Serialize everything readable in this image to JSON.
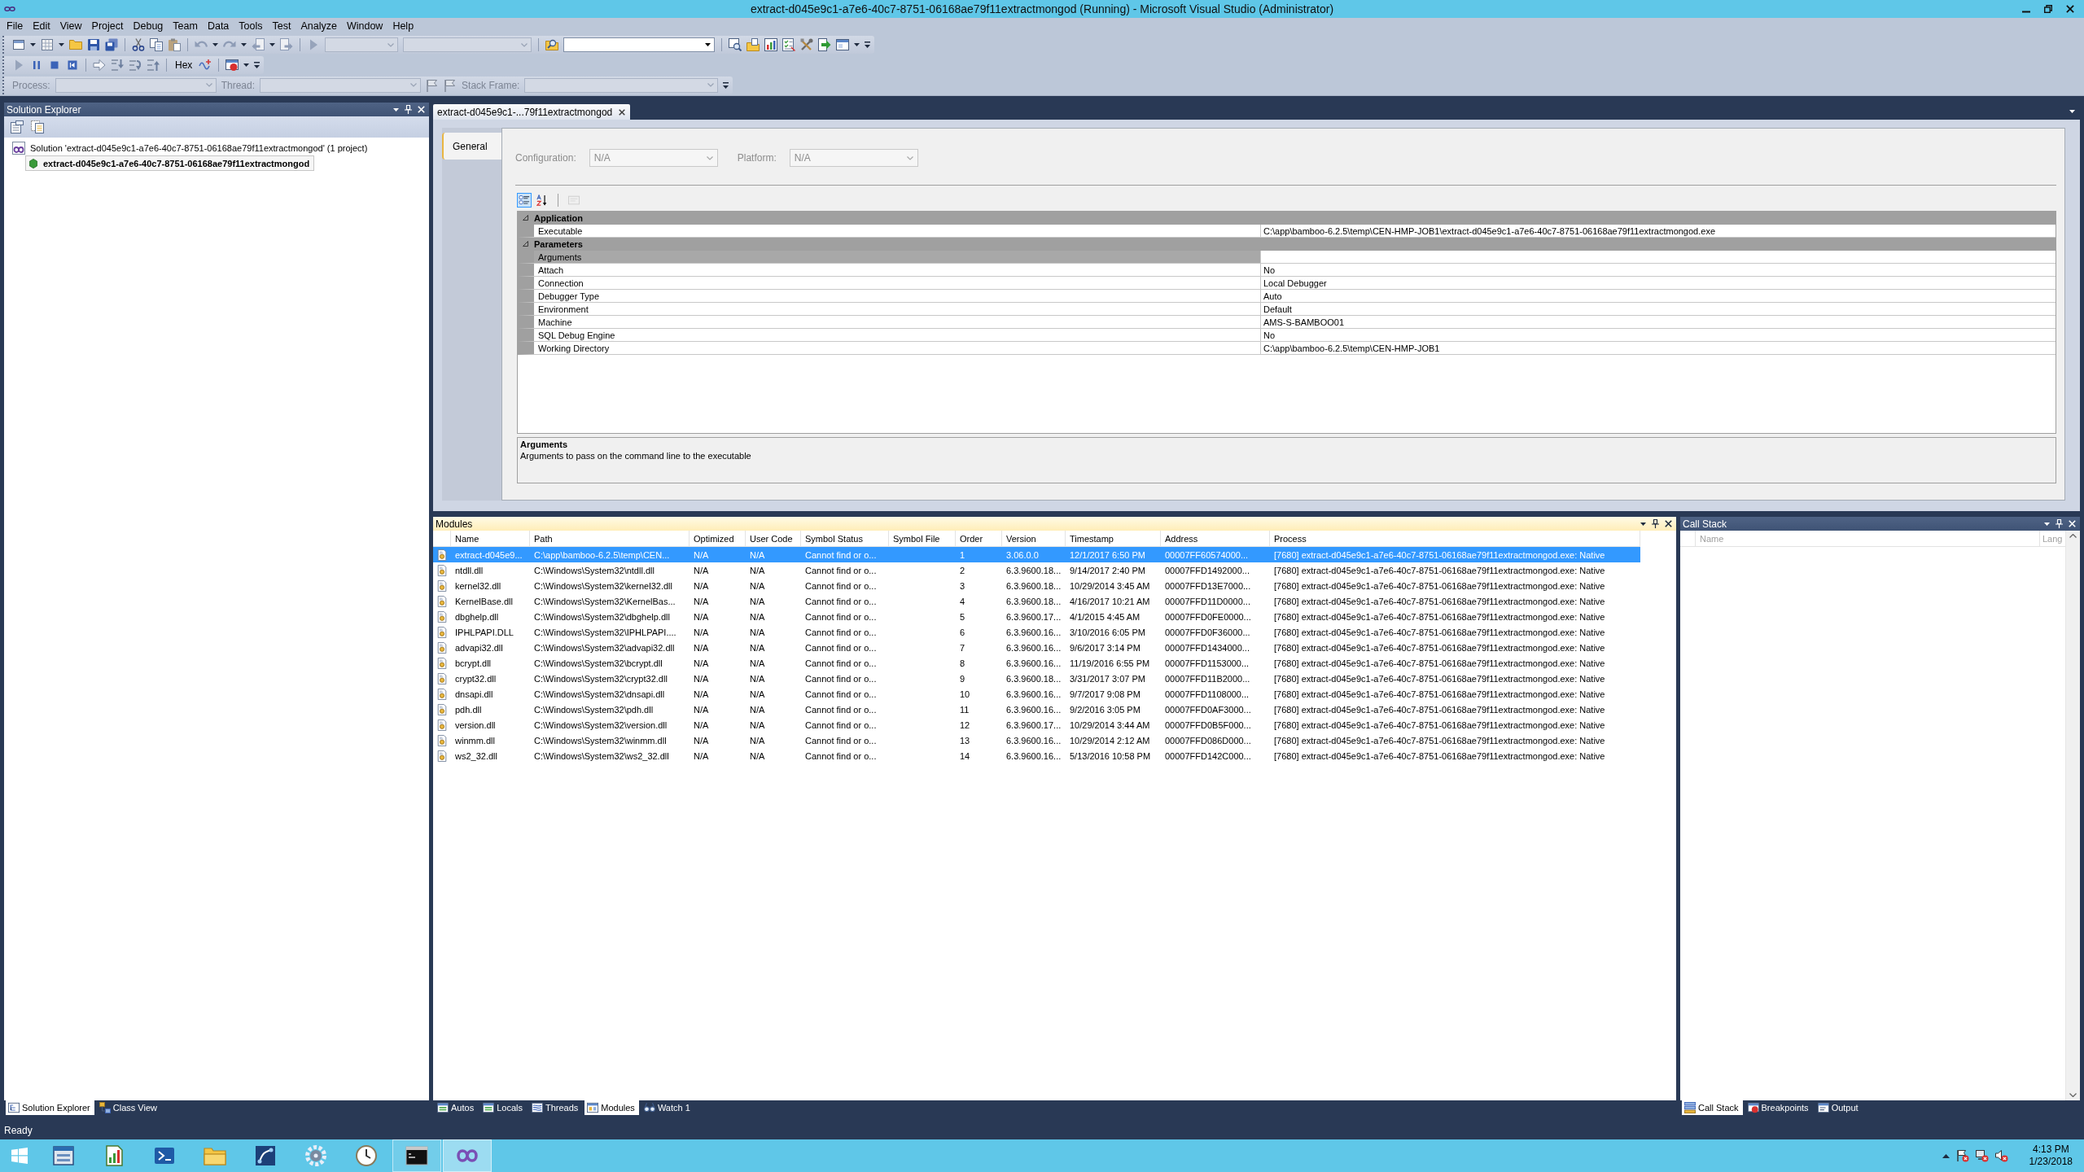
{
  "window": {
    "title": "extract-d045e9c1-a7e6-40c7-8751-06168ae79f11extractmongod (Running) - Microsoft Visual Studio (Administrator)"
  },
  "menu": [
    "File",
    "Edit",
    "View",
    "Project",
    "Debug",
    "Team",
    "Data",
    "Tools",
    "Test",
    "Analyze",
    "Window",
    "Help"
  ],
  "toolbar": {
    "combos": [
      {
        "disabled": true
      },
      {
        "disabled": true
      },
      {
        "disabled": false
      }
    ],
    "hex_button": "Hex"
  },
  "debug_location": {
    "disabled": true,
    "process_label": "Process:",
    "thread_label": "Thread:",
    "stack_frame_label": "Stack Frame:"
  },
  "solution_explorer": {
    "title": "Solution Explorer",
    "active": false,
    "tree": [
      {
        "label": "Solution 'extract-d045e9c1-a7e6-40c7-8751-06168ae79f11extractmongod' (1 project)",
        "kind": "solution",
        "selected": false,
        "children": [
          {
            "label": "extract-d045e9c1-a7e6-40c7-8751-06168ae79f11extractmongod",
            "kind": "project",
            "selected": true
          }
        ]
      }
    ],
    "tabs": [
      {
        "label": "Solution Explorer",
        "selected": true
      },
      {
        "label": "Class View",
        "selected": false
      }
    ]
  },
  "document": {
    "tabs": [
      {
        "label": "extract-d045e9c1-...79f11extractmongod",
        "selected": true
      }
    ],
    "nav": [
      {
        "label": "General",
        "selected": true
      }
    ],
    "configuration": {
      "label": "Configuration:",
      "value": "N/A",
      "disabled": true
    },
    "platform": {
      "label": "Platform:",
      "value": "N/A",
      "disabled": true
    },
    "grid_toolbar": [
      {
        "selected": true,
        "disabled": false
      },
      {
        "selected": false,
        "disabled": false
      },
      {
        "selected": false,
        "disabled": true
      }
    ],
    "grid": [
      {
        "title": "Application",
        "expanded": true,
        "rows": [
          {
            "name": "Executable",
            "value": "C:\\app\\bamboo-6.2.5\\temp\\CEN-HMP-JOB1\\extract-d045e9c1-a7e6-40c7-8751-06168ae79f11extractmongod.exe",
            "selected": false
          }
        ]
      },
      {
        "title": "Parameters",
        "expanded": true,
        "rows": [
          {
            "name": "Arguments",
            "selected": true
          },
          {
            "name": "Attach",
            "value": "No",
            "selected": false
          },
          {
            "name": "Connection",
            "value": "Local Debugger",
            "selected": false
          },
          {
            "name": "Debugger Type",
            "value": "Auto",
            "selected": false
          },
          {
            "name": "Environment",
            "value": "Default",
            "selected": false
          },
          {
            "name": "Machine",
            "value": "AMS-S-BAMBOO01",
            "selected": false
          },
          {
            "name": "SQL Debug Engine",
            "value": "No",
            "selected": false
          },
          {
            "name": "Working Directory",
            "value": "C:\\app\\bamboo-6.2.5\\temp\\CEN-HMP-JOB1",
            "selected": false
          }
        ]
      }
    ],
    "description": {
      "title": "Arguments",
      "text": "Arguments to pass on the command line to the executable"
    }
  },
  "modules": {
    "title": "Modules",
    "active": true,
    "columns": [
      "Name",
      "Path",
      "Optimized",
      "User Code",
      "Symbol Status",
      "Symbol File",
      "Order",
      "Version",
      "Timestamp",
      "Address",
      "Process"
    ],
    "rows": [
      {
        "name": "extract-d045e9...",
        "path": "C:\\app\\bamboo-6.2.5\\temp\\CEN...",
        "optimized": "N/A",
        "user_code": "N/A",
        "symbol_status": "Cannot find or o...",
        "order": "1",
        "version": "3.06.0.0",
        "timestamp": "12/1/2017 6:50 PM",
        "address": "00007FF60574000...",
        "process": "[7680] extract-d045e9c1-a7e6-40c7-8751-06168ae79f11extractmongod.exe: Native",
        "selected": true
      },
      {
        "name": "ntdll.dll",
        "path": "C:\\Windows\\System32\\ntdll.dll",
        "optimized": "N/A",
        "user_code": "N/A",
        "symbol_status": "Cannot find or o...",
        "order": "2",
        "version": "6.3.9600.18...",
        "timestamp": "9/14/2017 2:40 PM",
        "address": "00007FFD1492000...",
        "process": "[7680] extract-d045e9c1-a7e6-40c7-8751-06168ae79f11extractmongod.exe: Native",
        "selected": false
      },
      {
        "name": "kernel32.dll",
        "path": "C:\\Windows\\System32\\kernel32.dll",
        "optimized": "N/A",
        "user_code": "N/A",
        "symbol_status": "Cannot find or o...",
        "order": "3",
        "version": "6.3.9600.18...",
        "timestamp": "10/29/2014 3:45 AM",
        "address": "00007FFD13E7000...",
        "process": "[7680] extract-d045e9c1-a7e6-40c7-8751-06168ae79f11extractmongod.exe: Native",
        "selected": false
      },
      {
        "name": "KernelBase.dll",
        "path": "C:\\Windows\\System32\\KernelBas...",
        "optimized": "N/A",
        "user_code": "N/A",
        "symbol_status": "Cannot find or o...",
        "order": "4",
        "version": "6.3.9600.18...",
        "timestamp": "4/16/2017 10:21 AM",
        "address": "00007FFD11D0000...",
        "process": "[7680] extract-d045e9c1-a7e6-40c7-8751-06168ae79f11extractmongod.exe: Native",
        "selected": false
      },
      {
        "name": "dbghelp.dll",
        "path": "C:\\Windows\\System32\\dbghelp.dll",
        "optimized": "N/A",
        "user_code": "N/A",
        "symbol_status": "Cannot find or o...",
        "order": "5",
        "version": "6.3.9600.17...",
        "timestamp": "4/1/2015 4:45 AM",
        "address": "00007FFD0FE0000...",
        "process": "[7680] extract-d045e9c1-a7e6-40c7-8751-06168ae79f11extractmongod.exe: Native",
        "selected": false
      },
      {
        "name": "IPHLPAPI.DLL",
        "path": "C:\\Windows\\System32\\IPHLPAPI....",
        "optimized": "N/A",
        "user_code": "N/A",
        "symbol_status": "Cannot find or o...",
        "order": "6",
        "version": "6.3.9600.16...",
        "timestamp": "3/10/2016 6:05 PM",
        "address": "00007FFD0F36000...",
        "process": "[7680] extract-d045e9c1-a7e6-40c7-8751-06168ae79f11extractmongod.exe: Native",
        "selected": false
      },
      {
        "name": "advapi32.dll",
        "path": "C:\\Windows\\System32\\advapi32.dll",
        "optimized": "N/A",
        "user_code": "N/A",
        "symbol_status": "Cannot find or o...",
        "order": "7",
        "version": "6.3.9600.16...",
        "timestamp": "9/6/2017 3:14 PM",
        "address": "00007FFD1434000...",
        "process": "[7680] extract-d045e9c1-a7e6-40c7-8751-06168ae79f11extractmongod.exe: Native",
        "selected": false
      },
      {
        "name": "bcrypt.dll",
        "path": "C:\\Windows\\System32\\bcrypt.dll",
        "optimized": "N/A",
        "user_code": "N/A",
        "symbol_status": "Cannot find or o...",
        "order": "8",
        "version": "6.3.9600.16...",
        "timestamp": "11/19/2016 6:55 PM",
        "address": "00007FFD1153000...",
        "process": "[7680] extract-d045e9c1-a7e6-40c7-8751-06168ae79f11extractmongod.exe: Native",
        "selected": false
      },
      {
        "name": "crypt32.dll",
        "path": "C:\\Windows\\System32\\crypt32.dll",
        "optimized": "N/A",
        "user_code": "N/A",
        "symbol_status": "Cannot find or o...",
        "order": "9",
        "version": "6.3.9600.18...",
        "timestamp": "3/31/2017 3:07 PM",
        "address": "00007FFD11B2000...",
        "process": "[7680] extract-d045e9c1-a7e6-40c7-8751-06168ae79f11extractmongod.exe: Native",
        "selected": false
      },
      {
        "name": "dnsapi.dll",
        "path": "C:\\Windows\\System32\\dnsapi.dll",
        "optimized": "N/A",
        "user_code": "N/A",
        "symbol_status": "Cannot find or o...",
        "order": "10",
        "version": "6.3.9600.16...",
        "timestamp": "9/7/2017 9:08 PM",
        "address": "00007FFD1108000...",
        "process": "[7680] extract-d045e9c1-a7e6-40c7-8751-06168ae79f11extractmongod.exe: Native",
        "selected": false
      },
      {
        "name": "pdh.dll",
        "path": "C:\\Windows\\System32\\pdh.dll",
        "optimized": "N/A",
        "user_code": "N/A",
        "symbol_status": "Cannot find or o...",
        "order": "11",
        "version": "6.3.9600.16...",
        "timestamp": "9/2/2016 3:05 PM",
        "address": "00007FFD0AF3000...",
        "process": "[7680] extract-d045e9c1-a7e6-40c7-8751-06168ae79f11extractmongod.exe: Native",
        "selected": false
      },
      {
        "name": "version.dll",
        "path": "C:\\Windows\\System32\\version.dll",
        "optimized": "N/A",
        "user_code": "N/A",
        "symbol_status": "Cannot find or o...",
        "order": "12",
        "version": "6.3.9600.17...",
        "timestamp": "10/29/2014 3:44 AM",
        "address": "00007FFD0B5F000...",
        "process": "[7680] extract-d045e9c1-a7e6-40c7-8751-06168ae79f11extractmongod.exe: Native",
        "selected": false
      },
      {
        "name": "winmm.dll",
        "path": "C:\\Windows\\System32\\winmm.dll",
        "optimized": "N/A",
        "user_code": "N/A",
        "symbol_status": "Cannot find or o...",
        "order": "13",
        "version": "6.3.9600.16...",
        "timestamp": "10/29/2014 2:12 AM",
        "address": "00007FFD086D000...",
        "process": "[7680] extract-d045e9c1-a7e6-40c7-8751-06168ae79f11extractmongod.exe: Native",
        "selected": false
      },
      {
        "name": "ws2_32.dll",
        "path": "C:\\Windows\\System32\\ws2_32.dll",
        "optimized": "N/A",
        "user_code": "N/A",
        "symbol_status": "Cannot find or o...",
        "order": "14",
        "version": "6.3.9600.16...",
        "timestamp": "5/13/2016 10:58 PM",
        "address": "00007FFD142C000...",
        "process": "[7680] extract-d045e9c1-a7e6-40c7-8751-06168ae79f11extractmongod.exe: Native",
        "selected": false
      }
    ],
    "tabs": [
      {
        "label": "Autos",
        "selected": false
      },
      {
        "label": "Locals",
        "selected": false
      },
      {
        "label": "Threads",
        "selected": false
      },
      {
        "label": "Modules",
        "selected": true
      },
      {
        "label": "Watch 1",
        "selected": false
      }
    ]
  },
  "call_stack": {
    "title": "Call Stack",
    "active": false,
    "columns": [
      "Name",
      "Lang"
    ],
    "tabs": [
      {
        "label": "Call Stack",
        "selected": true
      },
      {
        "label": "Breakpoints",
        "selected": false
      },
      {
        "label": "Output",
        "selected": false
      }
    ]
  },
  "status_bar": {
    "text": "Ready"
  },
  "taskbar": {
    "apps": [
      {
        "running": false,
        "selected": false
      },
      {
        "running": false,
        "selected": false
      },
      {
        "running": false,
        "selected": false
      },
      {
        "running": false,
        "selected": false
      },
      {
        "running": false,
        "selected": false
      },
      {
        "running": false,
        "selected": false
      },
      {
        "running": false,
        "selected": false
      },
      {
        "running": true,
        "selected": false
      },
      {
        "running": true,
        "selected": true
      }
    ],
    "time": "4:13 PM",
    "date": "1/23/2018"
  }
}
